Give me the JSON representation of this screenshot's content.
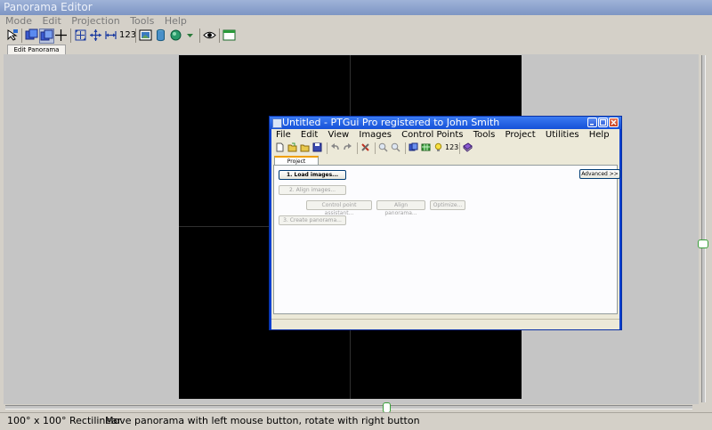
{
  "editor": {
    "title": "Panorama Editor",
    "menu": [
      "Mode",
      "Edit",
      "Projection",
      "Tools",
      "Help"
    ],
    "toolbar_text_button": "123",
    "tab": "Edit Panorama",
    "status": {
      "projection": "100° x 100° Rectilinear",
      "hint": "Move panorama with left mouse button, rotate with right button"
    }
  },
  "ptgui": {
    "title": "Untitled - PTGui Pro registered to John Smith",
    "menu": [
      "File",
      "Edit",
      "View",
      "Images",
      "Control Points",
      "Tools",
      "Project",
      "Utilities",
      "Help"
    ],
    "toolbar_text_button": "123",
    "tab": "Project Assistant",
    "buttons": {
      "load": "1. Load images...",
      "align": "2. Align images...",
      "cp_assistant": "Control point assistant...",
      "align_panorama": "Align panorama...",
      "optimize": "Optimize...",
      "create": "3. Create panorama...",
      "advanced": "Advanced >>"
    }
  },
  "colors": {
    "xp_blue": "#0a3fcf",
    "preview_bg": "#000000",
    "editor_bg": "#c5c5c5",
    "slider_accent": "#3aa03a"
  }
}
